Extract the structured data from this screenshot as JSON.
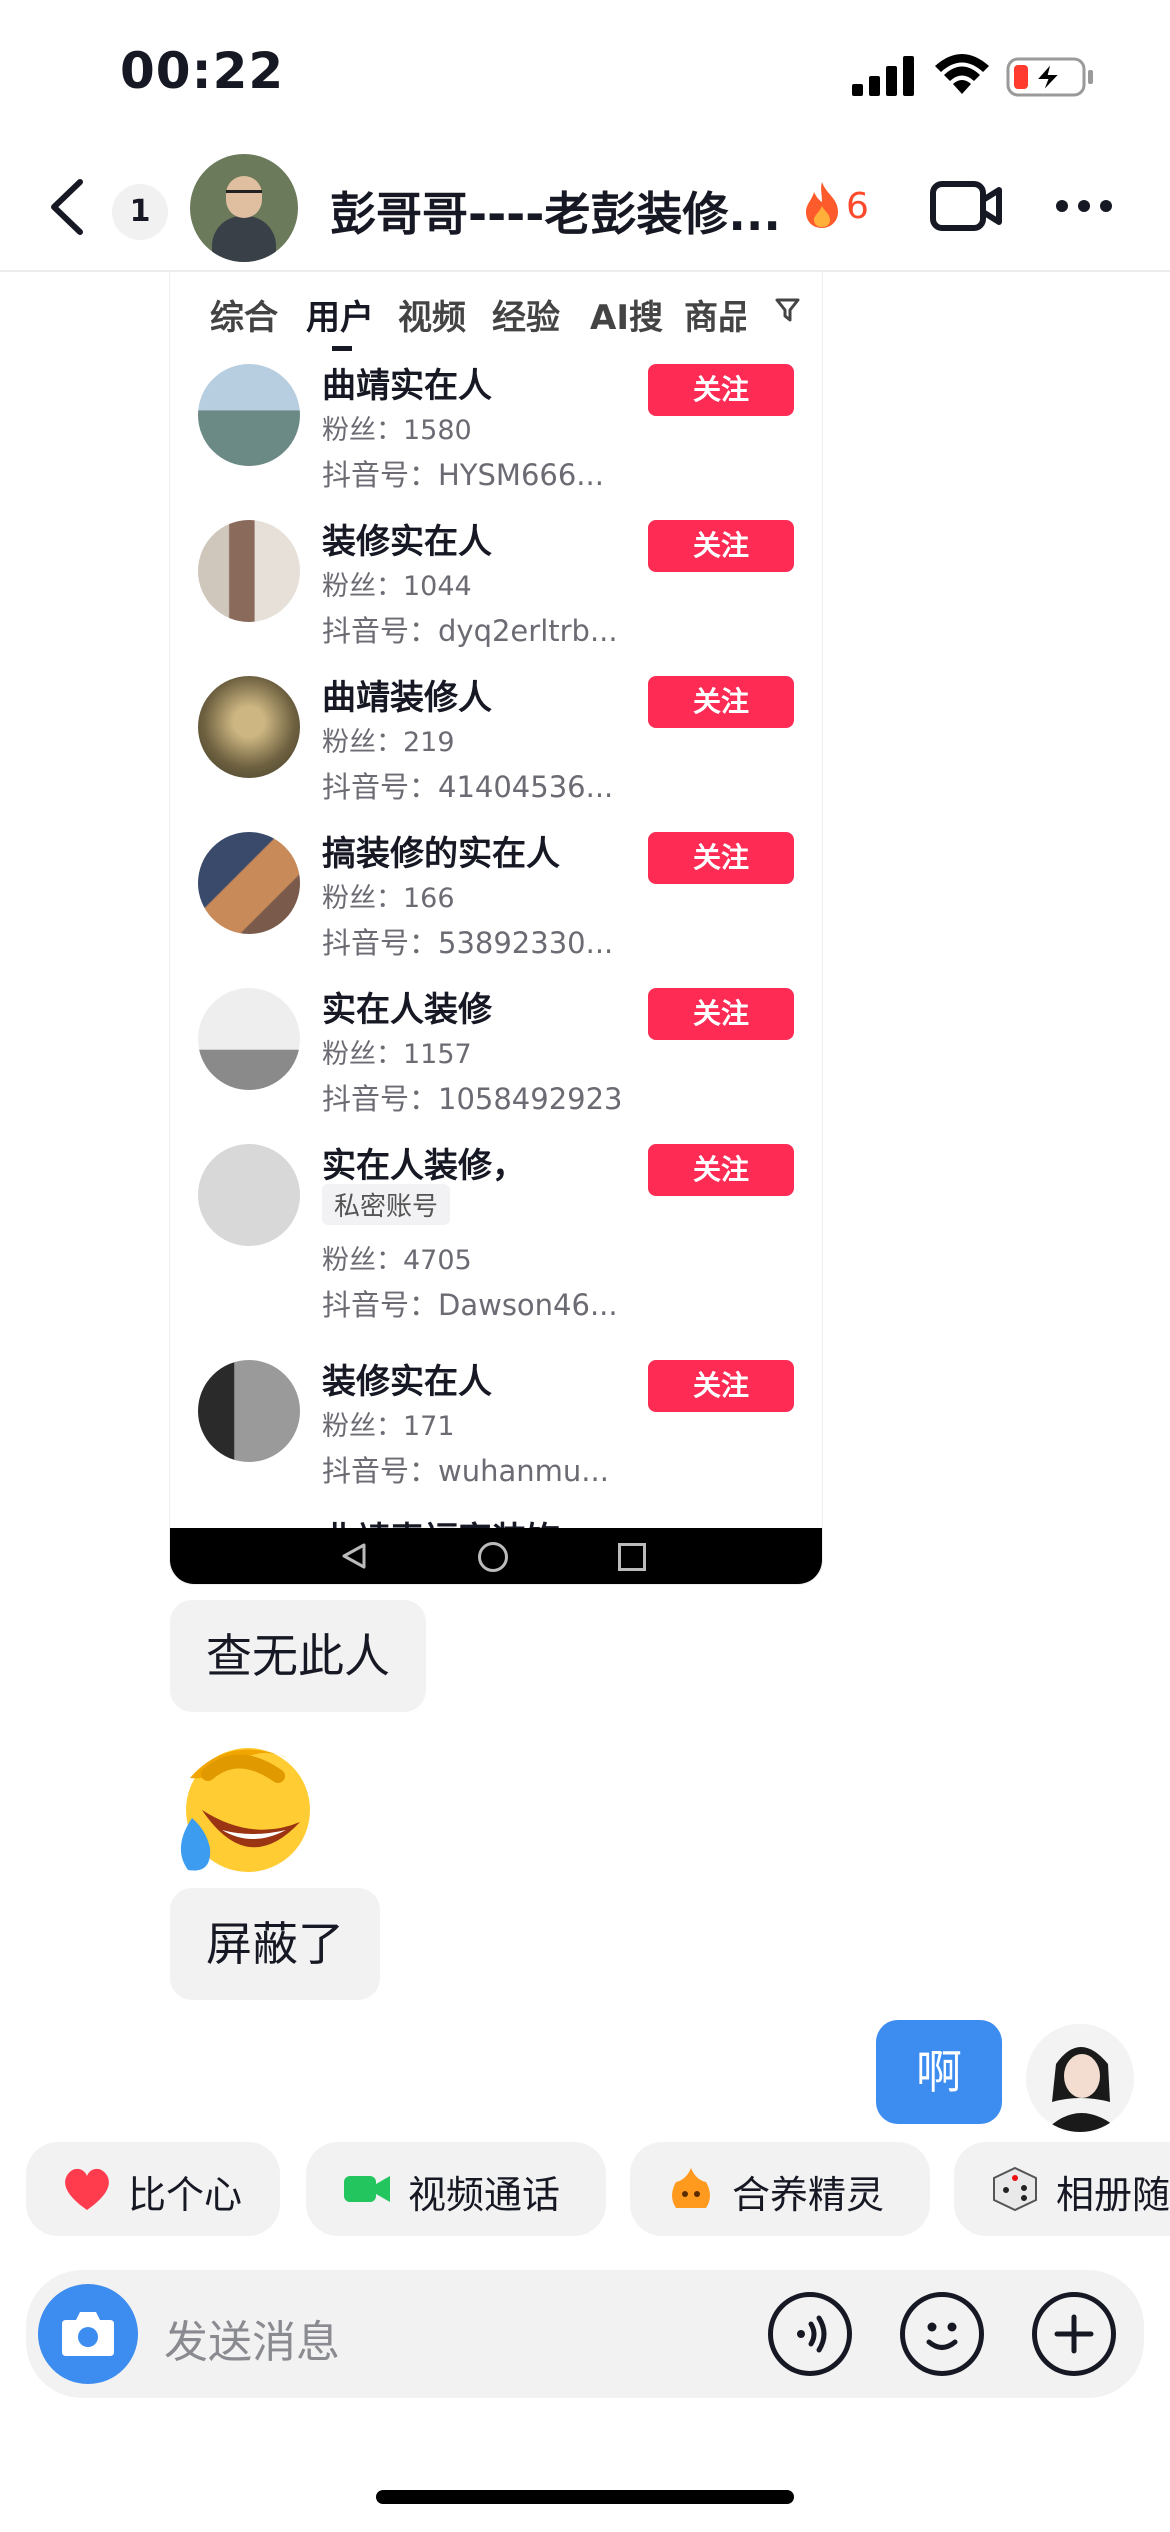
{
  "status_bar": {
    "time": "00:22",
    "signal_icon": "cellular-signal-icon",
    "wifi_icon": "wifi-icon",
    "battery_icon": "battery-charging-icon",
    "battery_color": "#ff3b30"
  },
  "header": {
    "unread_count": "1",
    "title": "彭哥哥----老彭装修...",
    "streak_count": "6",
    "streak_color": "#fe4a2a"
  },
  "shared_screenshot": {
    "tabs": [
      "综合",
      "用户",
      "视频",
      "经验",
      "AI搜",
      "商品"
    ],
    "active_tab": "用户",
    "users": [
      {
        "name": "曲靖实在人",
        "fans": "粉丝：1580",
        "douyin_id": "抖音号：HYSM666...",
        "follow": "关注"
      },
      {
        "name": "装修实在人",
        "fans": "粉丝：1044",
        "douyin_id": "抖音号：dyq2erltrb...",
        "follow": "关注"
      },
      {
        "name": "曲靖装修人",
        "fans": "粉丝：219",
        "douyin_id": "抖音号：41404536...",
        "follow": "关注"
      },
      {
        "name": "搞装修的实在人",
        "fans": "粉丝：166",
        "douyin_id": "抖音号：53892330...",
        "follow": "关注"
      },
      {
        "name": "实在人装修",
        "fans": "粉丝：1157",
        "douyin_id": "抖音号：1058492923",
        "follow": "关注"
      },
      {
        "name": "实在人装修，",
        "tag": "私密账号",
        "fans": "粉丝：4705",
        "douyin_id": "抖音号：Dawson46...",
        "follow": "关注"
      },
      {
        "name": "装修实在人",
        "fans": "粉丝：171",
        "douyin_id": "抖音号：wuhanmu...",
        "follow": "关注"
      }
    ],
    "partial_next_name": "曲靖麦福家装饰"
  },
  "messages": {
    "incoming_1": "查无此人",
    "sticker": "laughing-crying-face-emoji",
    "incoming_2": "屏蔽了",
    "outgoing_1": "啊"
  },
  "quick_actions": [
    {
      "label": "比个心",
      "icon": "heart-icon"
    },
    {
      "label": "视频通话",
      "icon": "video-camera-icon"
    },
    {
      "label": "合养精灵",
      "icon": "spirit-pet-icon"
    },
    {
      "label": "相册随",
      "icon": "dice-icon"
    }
  ],
  "input": {
    "placeholder": "发送消息"
  },
  "colors": {
    "follow_button": "#fe2c55",
    "outgoing_bubble": "#3d8cf0",
    "incoming_bubble": "#f2f2f3"
  }
}
